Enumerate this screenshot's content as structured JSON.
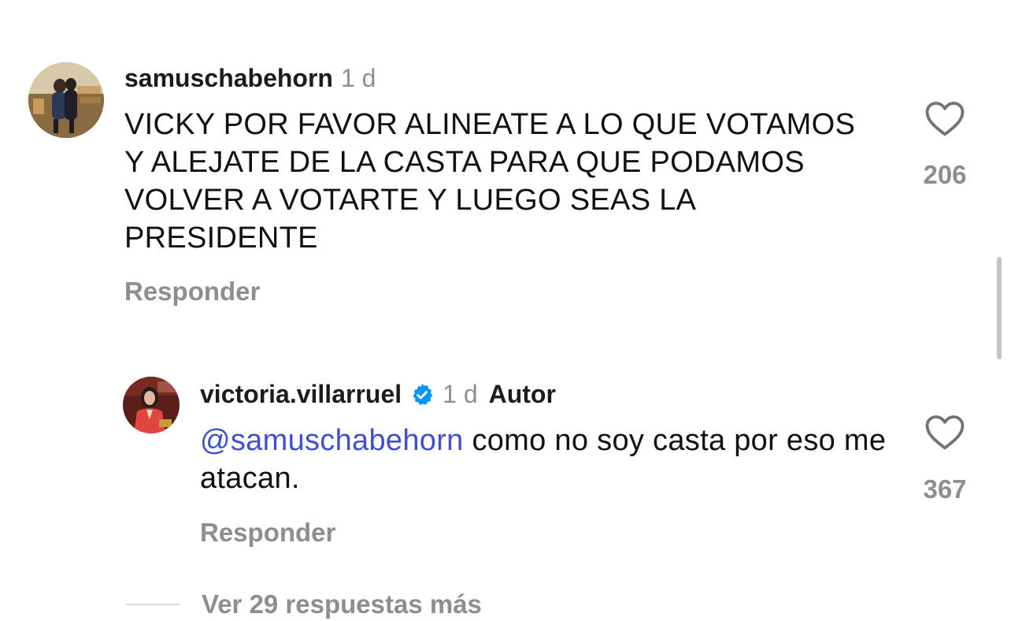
{
  "comments": [
    {
      "username": "samuschabehorn",
      "time": "1 d",
      "text": "VICKY POR FAVOR ALINEATE A LO QUE VOTAMOS Y ALEJATE DE LA CASTA PARA QUE PODAMOS VOLVER A VOTARTE Y LUEGO SEAS LA PRESIDENTE",
      "reply_label": "Responder",
      "likes": "206",
      "like_icon": "heart-outline-icon"
    }
  ],
  "reply": {
    "username": "victoria.villarruel",
    "verified_icon": "verified-badge-icon",
    "time": "1 d",
    "author_label": "Autor",
    "mention": "@samuschabehorn",
    "text": " como no soy casta por eso me atacan.",
    "reply_label": "Responder",
    "likes": "367",
    "like_icon": "heart-outline-icon"
  },
  "view_more": {
    "label": "Ver 29 respuestas más"
  },
  "colors": {
    "mention": "#3f4fd4",
    "secondary_text": "#8e8e8e",
    "verified_badge": "#0095f6"
  }
}
